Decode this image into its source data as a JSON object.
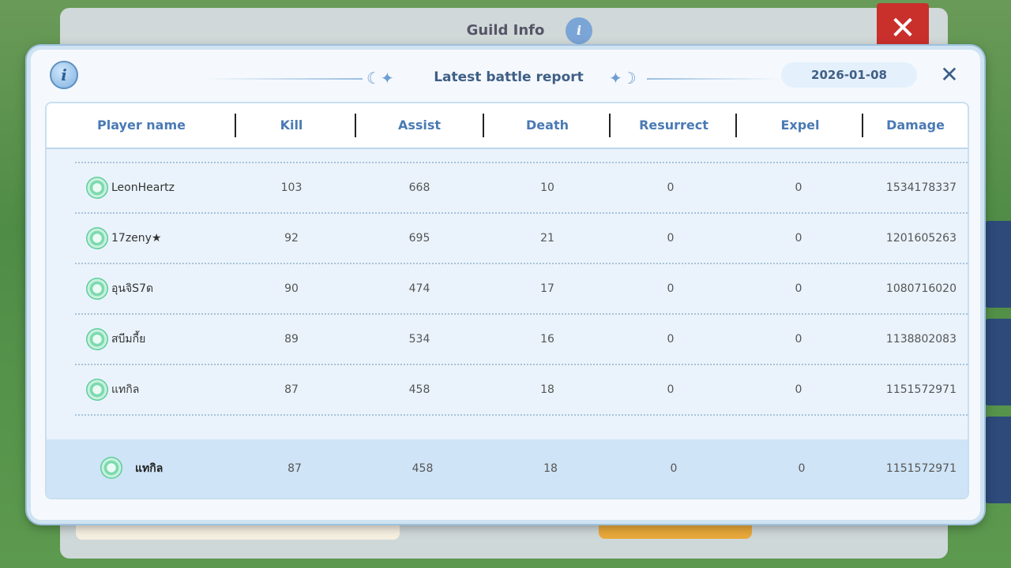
{
  "background": {
    "title": "Guild Info"
  },
  "modal": {
    "title": "Latest battle report",
    "date": "2026-01-08",
    "info_icon": "info-icon",
    "close_icon": "close-icon"
  },
  "table": {
    "headers": [
      "Player name",
      "Kill",
      "Assist",
      "Death",
      "Resurrect",
      "Expel",
      "Damage"
    ],
    "rows": [
      {
        "name": "LeonHeartz",
        "kill": "103",
        "assist": "668",
        "death": "10",
        "resurrect": "0",
        "expel": "0",
        "damage": "1534178337"
      },
      {
        "name": "17zeny★",
        "kill": "92",
        "assist": "695",
        "death": "21",
        "resurrect": "0",
        "expel": "0",
        "damage": "1201605263"
      },
      {
        "name": "อุนจิS7ด",
        "kill": "90",
        "assist": "474",
        "death": "17",
        "resurrect": "0",
        "expel": "0",
        "damage": "1080716020"
      },
      {
        "name": "สบีมกี้ย",
        "kill": "89",
        "assist": "534",
        "death": "16",
        "resurrect": "0",
        "expel": "0",
        "damage": "1138802083"
      },
      {
        "name": "แทกิล",
        "kill": "87",
        "assist": "458",
        "death": "18",
        "resurrect": "0",
        "expel": "0",
        "damage": "1151572971"
      }
    ],
    "self_row": {
      "name": "แทกิล",
      "kill": "87",
      "assist": "458",
      "death": "18",
      "resurrect": "0",
      "expel": "0",
      "damage": "1151572971"
    }
  },
  "colors": {
    "header_text": "#4a7ab4",
    "self_row_bg": "#cfe4f6",
    "modal_bg": "#f5f9fd"
  }
}
